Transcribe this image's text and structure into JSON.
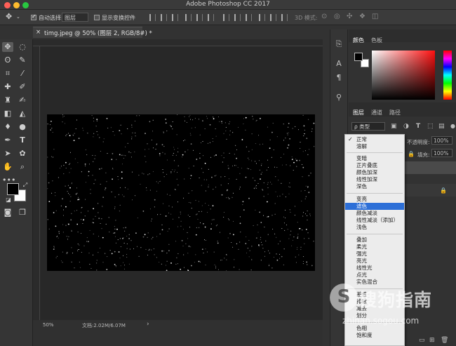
{
  "window": {
    "title": "Adobe Photoshop CC 2017"
  },
  "colors": {
    "close": "#fe5f57",
    "minimize": "#febc2e",
    "maximize": "#28c840",
    "highlight": "#2d6fd7"
  },
  "options_bar": {
    "auto_select_label": "自动选择:",
    "auto_select_value": "图层",
    "show_transform_label": "显示变换控件",
    "mode_3d_label": "3D 模式:"
  },
  "document": {
    "tab_title": "timg.jpeg @ 50% (图层 2, RGB/8#) *",
    "tab_close": "×",
    "zoom": "50%",
    "doc_info": "文档:2.02M/6.07M"
  },
  "panels": {
    "color_tab": "颜色",
    "swatches_tab": "色板",
    "layers_tab": "图层",
    "channels_tab": "通道",
    "paths_tab": "路径",
    "filter_kind": "ρ 类型",
    "opacity_label": "不透明度:",
    "opacity_value": "100%",
    "fill_label": "填充:",
    "fill_value": "100%"
  },
  "blend_modes": {
    "checked": "✓",
    "g1": [
      "正常",
      "溶解"
    ],
    "g2": [
      "变暗",
      "正片叠底",
      "颜色加深",
      "线性加深",
      "深色"
    ],
    "g3": [
      "变亮",
      "滤色",
      "颜色减淡",
      "线性减淡（添加）",
      "浅色"
    ],
    "g4": [
      "叠加",
      "柔光",
      "强光",
      "亮光",
      "线性光",
      "点光",
      "实色混合"
    ],
    "g5": [
      "差值",
      "排除",
      "减去",
      "划分"
    ],
    "g6": [
      "色相",
      "饱和度"
    ]
  },
  "watermark": {
    "logo_letter": "S",
    "brand": "搜狗指南",
    "url": "zhinan.sogou.com"
  }
}
